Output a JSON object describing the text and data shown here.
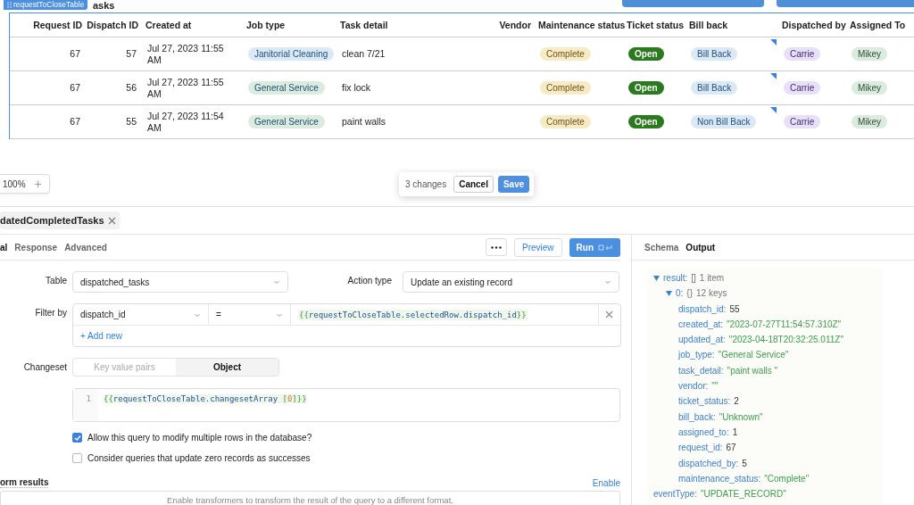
{
  "canvas": {
    "title_fragment": "asks",
    "table_tag": "requestToCloseTable",
    "table": {
      "columns": [
        {
          "label": "Request ID"
        },
        {
          "label": "Dispatch ID"
        },
        {
          "label": "Created at"
        },
        {
          "label": "Job type"
        },
        {
          "label": "Task detail"
        },
        {
          "label": "Vendor"
        },
        {
          "label": "Maintenance status"
        },
        {
          "label": "Ticket status"
        },
        {
          "label": "Bill back"
        },
        {
          "label": "Dispatched by"
        },
        {
          "label": "Assigned To"
        }
      ],
      "rows": [
        {
          "request_id": "67",
          "dispatch_id": "57",
          "created_at": "Jul 27, 2023 11:55 AM",
          "job_type": {
            "label": "Janitorial Cleaning",
            "color": "#dbe9f6"
          },
          "task_detail": "clean 7/21",
          "maintenance_status": "Complete",
          "ticket_status": "Open",
          "bill_back": {
            "label": "Bill Back",
            "edited": true
          },
          "dispatched_by": "Carrie",
          "assigned_to": "Mikey"
        },
        {
          "request_id": "67",
          "dispatch_id": "56",
          "created_at": "Jul 27, 2023 11:55 AM",
          "job_type": {
            "label": "General Service",
            "color": "#dcebdf"
          },
          "task_detail": "fix lock",
          "maintenance_status": "Complete",
          "ticket_status": "Open",
          "bill_back": {
            "label": "Bill Back",
            "edited": true
          },
          "dispatched_by": "Carrie",
          "assigned_to": "Mikey"
        },
        {
          "request_id": "67",
          "dispatch_id": "55",
          "created_at": "Jul 27, 2023 11:54 AM",
          "job_type": {
            "label": "General Service",
            "color": "#dcebdf"
          },
          "task_detail": "paint walls",
          "maintenance_status": "Complete",
          "ticket_status": "Open",
          "bill_back": {
            "label": "Non Bill Back",
            "edited": true
          },
          "dispatched_by": "Carrie",
          "assigned_to": "Mikey"
        }
      ]
    },
    "zoom": {
      "value": "100%",
      "plus": "+"
    },
    "changes_bar": {
      "count": "3 changes",
      "cancel": "Cancel",
      "save": "Save"
    }
  },
  "query_tab": {
    "label": "datedCompletedTasks"
  },
  "editor": {
    "tabs": [
      {
        "label": "al",
        "selected": true
      },
      {
        "label": "Response",
        "selected": false
      },
      {
        "label": "Advanced",
        "selected": false
      }
    ],
    "preview": "Preview",
    "run": "Run",
    "table_label": "Table",
    "table_value": "dispatched_tasks",
    "action_label": "Action type",
    "action_value": "Update an existing record",
    "filter_label": "Filter by",
    "filter_column": "dispatch_id",
    "filter_operator": "=",
    "filter_value": [
      {
        "text": "{{",
        "kind": "brace"
      },
      {
        "text": "requestToCloseTable",
        "kind": "ident"
      },
      {
        "text": ".selectedRow.dispatch_id",
        "kind": "ident"
      },
      {
        "text": "}}",
        "kind": "brace"
      }
    ],
    "add_new": "+ Add new",
    "changeset_label": "Changeset",
    "changeset_modes": [
      {
        "label": "Key value pairs",
        "selected": false
      },
      {
        "label": "Object",
        "selected": true
      }
    ],
    "code_line_number": "1",
    "code": [
      {
        "text": "{{",
        "kind": "brace"
      },
      {
        "text": "requestToCloseTable.changesetArray ",
        "kind": "ident"
      },
      {
        "text": "[",
        "kind": "brace"
      },
      {
        "text": "0",
        "kind": "number"
      },
      {
        "text": "]}}",
        "kind": "brace"
      }
    ],
    "options": [
      {
        "label": "Allow this query to modify multiple rows in the database?",
        "checked": true
      },
      {
        "label": "Consider queries that update zero records as successes",
        "checked": false
      }
    ],
    "transform_label": "orm results",
    "transform_enable": "Enable",
    "transform_hint": "Enable transformers to transform the result of the query to a different format."
  },
  "output_panel": {
    "tabs": [
      {
        "label": "Schema",
        "selected": false
      },
      {
        "label": "Output",
        "selected": true
      }
    ],
    "tree": [
      {
        "key": "result:",
        "type": "[]",
        "summary": "1 item",
        "expanded": true,
        "children": [
          {
            "key": "0:",
            "type": "{}",
            "summary": "12 keys",
            "expanded": true,
            "children": [
              {
                "key": "dispatch_id:",
                "value": "55",
                "kind": "number"
              },
              {
                "key": "created_at:",
                "value": "\"2023-07-27T11:54:57.310Z\"",
                "kind": "string"
              },
              {
                "key": "updated_at:",
                "value": "\"2023-04-18T20:32:25.011Z\"",
                "kind": "string"
              },
              {
                "key": "job_type:",
                "value": "\"General Service\"",
                "kind": "string"
              },
              {
                "key": "task_detail:",
                "value": "\"paint walls \"",
                "kind": "string"
              },
              {
                "key": "vendor:",
                "value": "\"\"",
                "kind": "string"
              },
              {
                "key": "ticket_status:",
                "value": "2",
                "kind": "number"
              },
              {
                "key": "bill_back:",
                "value": "\"Unknown\"",
                "kind": "string"
              },
              {
                "key": "assigned_to:",
                "value": "1",
                "kind": "number"
              },
              {
                "key": "request_id:",
                "value": "67",
                "kind": "number"
              },
              {
                "key": "dispatched_by:",
                "value": "5",
                "kind": "number"
              },
              {
                "key": "maintenance_status:",
                "value": "\"Complete\"",
                "kind": "string"
              }
            ]
          }
        ]
      },
      {
        "key": "eventType:",
        "value": "\"UPDATE_RECORD\"",
        "kind": "string"
      }
    ]
  }
}
